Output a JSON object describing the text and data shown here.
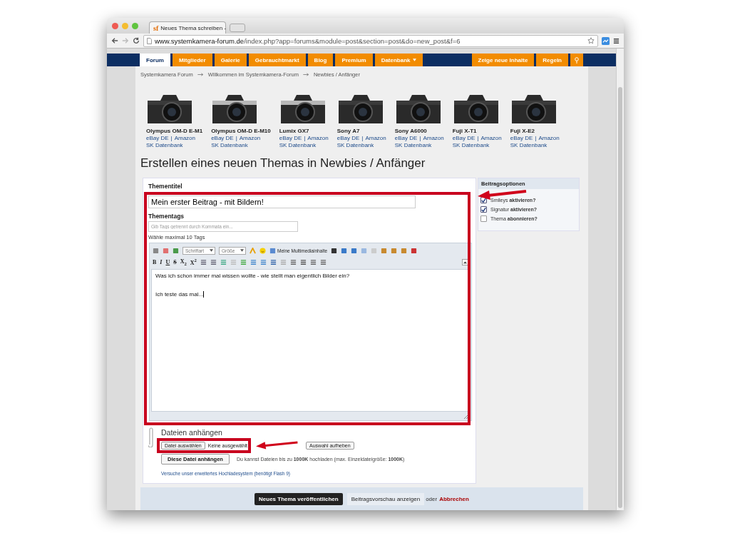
{
  "browser": {
    "favicon_text": "sf",
    "tab_title": "Neues Thema schreiben -",
    "url_host": "www.systemkamera-forum.de",
    "url_path": "/index.php?app=forums&module=post&section=post&do=new_post&f=6"
  },
  "nav": {
    "left": [
      {
        "label": "Forum",
        "selected": true,
        "dropdown": false
      },
      {
        "label": "Mitglieder",
        "selected": false,
        "dropdown": false
      },
      {
        "label": "Galerie",
        "selected": false,
        "dropdown": false
      },
      {
        "label": "Gebrauchtmarkt",
        "selected": false,
        "dropdown": false
      },
      {
        "label": "Blog",
        "selected": false,
        "dropdown": false
      },
      {
        "label": "Premium",
        "selected": false,
        "dropdown": false
      },
      {
        "label": "Datenbank",
        "selected": false,
        "dropdown": true
      }
    ],
    "right": [
      {
        "label": "Zeige neue Inhalte"
      },
      {
        "label": "Regeln"
      }
    ]
  },
  "breadcrumbs": [
    "Systemkamera Forum",
    "Willkommen im Systemkamera-Forum",
    "Newbies / Anfänger"
  ],
  "cameras": [
    {
      "name": "Olympus OM-D E-M1",
      "link_1": "eBay DE",
      "separator": "|",
      "link_2": "Amazon",
      "link_3": "SK Datenbank"
    },
    {
      "name": "Olympus OM-D E-M10",
      "link_1": "eBay DE",
      "separator": "|",
      "link_2": "Amazon",
      "link_3": "SK Datenbank"
    },
    {
      "name": "Lumix GX7",
      "link_1": "eBay DE",
      "separator": "|",
      "link_2": "Amazon",
      "link_3": "SK Datenbank"
    },
    {
      "name": "Sony A7",
      "link_1": "eBay DE",
      "separator": "|",
      "link_2": "Amazon",
      "link_3": "SK Datenbank"
    },
    {
      "name": "Sony A6000",
      "link_1": "eBay DE",
      "separator": "|",
      "link_2": "Amazon",
      "link_3": "SK Datenbank"
    },
    {
      "name": "Fuji X-T1",
      "link_1": "eBay DE",
      "separator": "|",
      "link_2": "Amazon",
      "link_3": "SK Datenbank"
    },
    {
      "name": "Fuji X-E2",
      "link_1": "eBay DE",
      "separator": "|",
      "link_2": "Amazon",
      "link_3": "SK Datenbank"
    }
  ],
  "heading": "Erstellen eines neuen Themas in Newbies / Anfänger",
  "form": {
    "title_label": "Thementitel",
    "title_value": "Mein erster Beitrag - mit Bildern!",
    "tags_label": "Thementags",
    "tags_placeholder": "Gib Tags getrennt durch Kommata ein...",
    "tags_hint": "Wähle maximal 10 Tags",
    "editor": {
      "font_select": "Schriftart",
      "size_select": "Größe",
      "media_button": "Meine Multimediainhalte",
      "format_buttons": [
        "B",
        "I",
        "U",
        "S",
        "X$_{2}$",
        "X$^{2}$"
      ],
      "lines": [
        "Was ich schon immer mal wissen wollte - wie stellt man eigentlich Bilder ein?",
        "Ich teste das mal..."
      ]
    }
  },
  "options": {
    "title": "Beitragsoptionen",
    "items": [
      {
        "text": "Smileys **aktivieren?**",
        "checked": true
      },
      {
        "text": "Signatur **aktivieren?**",
        "checked": true
      },
      {
        "text": "Thema **abonnieren?**",
        "checked": false
      }
    ]
  },
  "attachments": {
    "heading": "Dateien anhängen",
    "choose_button": "Datei auswählen",
    "no_file": "Keine ausgewählt",
    "clear_button": "Auswahl aufheben",
    "attach_button": "Diese Datei anhängen",
    "limit_text": "Du kannst Dateien bis zu **1000K** hochladen (max. Einzeldateigröße: **1000K**)",
    "flash_link": "Versuche unser erweitertes Hochladesystem (benötigt Flash 9)"
  },
  "footer": {
    "submit": "Neues Thema veröffentlichen",
    "preview": "Beitragsvorschau anzeigen",
    "or": "oder",
    "cancel": "Abbrechen"
  }
}
